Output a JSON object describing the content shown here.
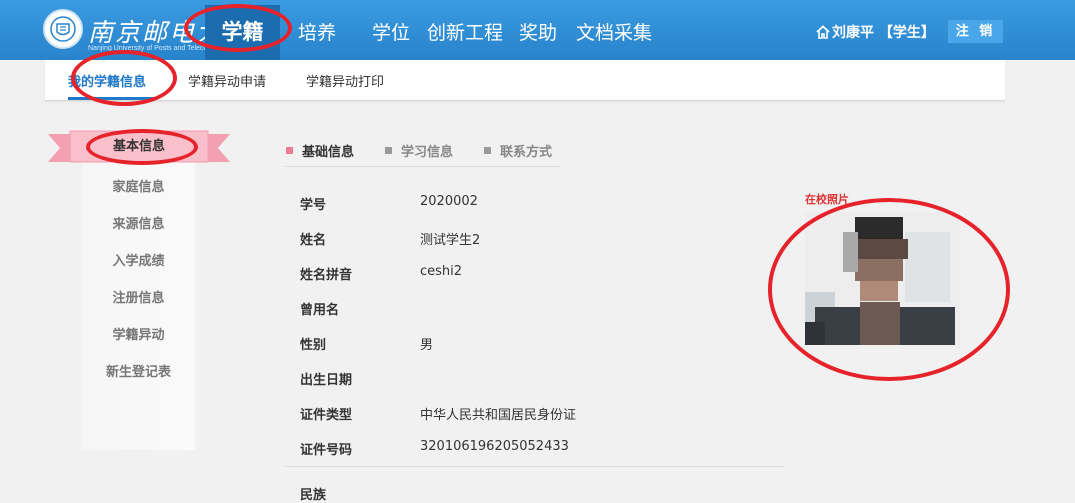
{
  "header": {
    "logo_text": "南京邮电大学",
    "logo_subtext": "Nanjing University of Posts and Telecommunications",
    "nav": {
      "active": "学籍",
      "items": [
        "培养",
        "学位",
        "创新工程",
        "奖助",
        "文档采集"
      ]
    },
    "user": "刘康平 【学生】",
    "logout_label": "注 销",
    "home_icon": "home-icon"
  },
  "subnav": {
    "tabs": [
      "我的学籍信息",
      "学籍异动申请",
      "学籍异动打印"
    ],
    "active_index": 0
  },
  "leftmenu": {
    "items": [
      "基本信息",
      "家庭信息",
      "来源信息",
      "入学成绩",
      "注册信息",
      "学籍异动",
      "新生登记表"
    ],
    "active_index": 0
  },
  "content_tabs": {
    "items": [
      "基础信息",
      "学习信息",
      "联系方式"
    ],
    "active_index": 0
  },
  "fields": [
    {
      "label": "学号",
      "value": "2020002"
    },
    {
      "label": "姓名",
      "value": "测试学生2"
    },
    {
      "label": "姓名拼音",
      "value": "ceshi2"
    },
    {
      "label": "曾用名",
      "value": ""
    },
    {
      "label": "性别",
      "value": "男"
    },
    {
      "label": "出生日期",
      "value": ""
    },
    {
      "label": "证件类型",
      "value": "中华人民共和国居民身份证"
    },
    {
      "label": "证件号码",
      "value": "320106196205052433"
    },
    {
      "label": "民族",
      "value": ""
    }
  ],
  "photo": {
    "label": "在校照片"
  },
  "colors": {
    "topbar": "#2884cc",
    "active_nav": "#1c6db0",
    "subtab_active": "#1f78c8",
    "ribbon": "#f7a8b8",
    "annotation": "#e6232b"
  }
}
